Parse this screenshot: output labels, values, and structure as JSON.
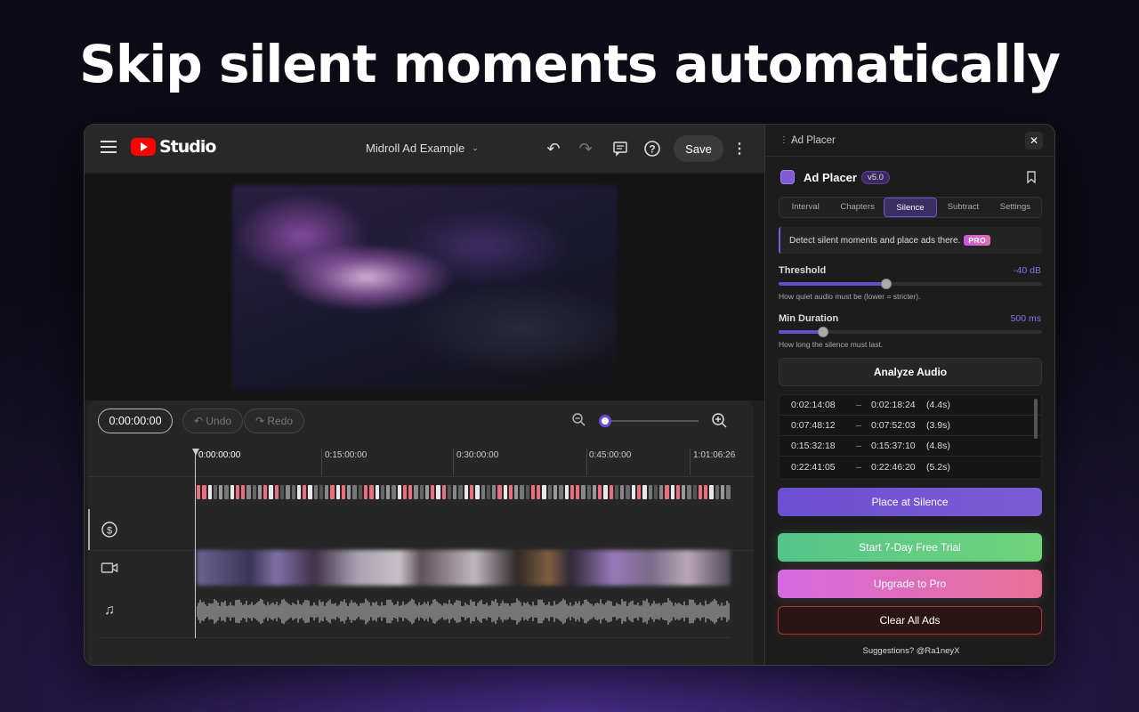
{
  "headline": "Skip silent moments automatically",
  "studio": {
    "logo_text": "Studio",
    "project_title": "Midroll Ad Example",
    "save_label": "Save",
    "timecode": "0:00:00:00",
    "undo_label": "Undo",
    "redo_label": "Redo",
    "ruler_ticks": [
      "0:00:00:00",
      "0:15:00:00",
      "0:30:00:00",
      "0:45:00:00",
      "1:01:06:26"
    ],
    "zoom_level": 0,
    "icons": {
      "menu": "hamburger-menu-icon",
      "undo": "undo-icon",
      "redo": "redo-icon",
      "feedback": "feedback-icon",
      "help": "help-icon",
      "more": "more-vert-icon",
      "zoom_out": "zoom-out-icon",
      "zoom_in": "zoom-in-icon",
      "ads_track": "dollar-icon",
      "video_track": "video-camera-icon",
      "audio_track": "music-note-icon"
    }
  },
  "panel": {
    "header_title": "Ad Placer",
    "app_name": "Ad Placer",
    "version": "v5.0",
    "tabs": [
      "Interval",
      "Chapters",
      "Silence",
      "Subtract",
      "Settings"
    ],
    "active_tab": "Silence",
    "info_text": "Detect silent moments and place ads there.",
    "pro_badge": "PRO",
    "threshold": {
      "label": "Threshold",
      "value_text": "-40 dB",
      "fraction": 0.41,
      "hint": "How quiet audio must be (lower = stricter)."
    },
    "min_duration": {
      "label": "Min Duration",
      "value_text": "500 ms",
      "fraction": 0.17,
      "hint": "How long the silence must last."
    },
    "analyze_label": "Analyze Audio",
    "results": [
      {
        "start": "0:02:14:08",
        "end": "0:02:18:24",
        "duration": "(4.4s)"
      },
      {
        "start": "0:07:48:12",
        "end": "0:07:52:03",
        "duration": "(3.9s)"
      },
      {
        "start": "0:15:32:18",
        "end": "0:15:37:10",
        "duration": "(4.8s)"
      },
      {
        "start": "0:22:41:05",
        "end": "0:22:46:20",
        "duration": "(5.2s)"
      }
    ],
    "place_label": "Place at Silence",
    "trial_label": "Start 7-Day Free Trial",
    "upgrade_label": "Upgrade to Pro",
    "clear_label": "Clear All Ads",
    "footer": "Suggestions? @Ra1neyX"
  },
  "colors": {
    "accent": "#6d4fd2",
    "value_text": "#8a70f0",
    "trial": "#55c48a",
    "upgrade": "#e070b0",
    "danger": "#a83838",
    "ad_marker_pink": "#e8707e",
    "ad_marker_white": "#e8e8e8"
  }
}
